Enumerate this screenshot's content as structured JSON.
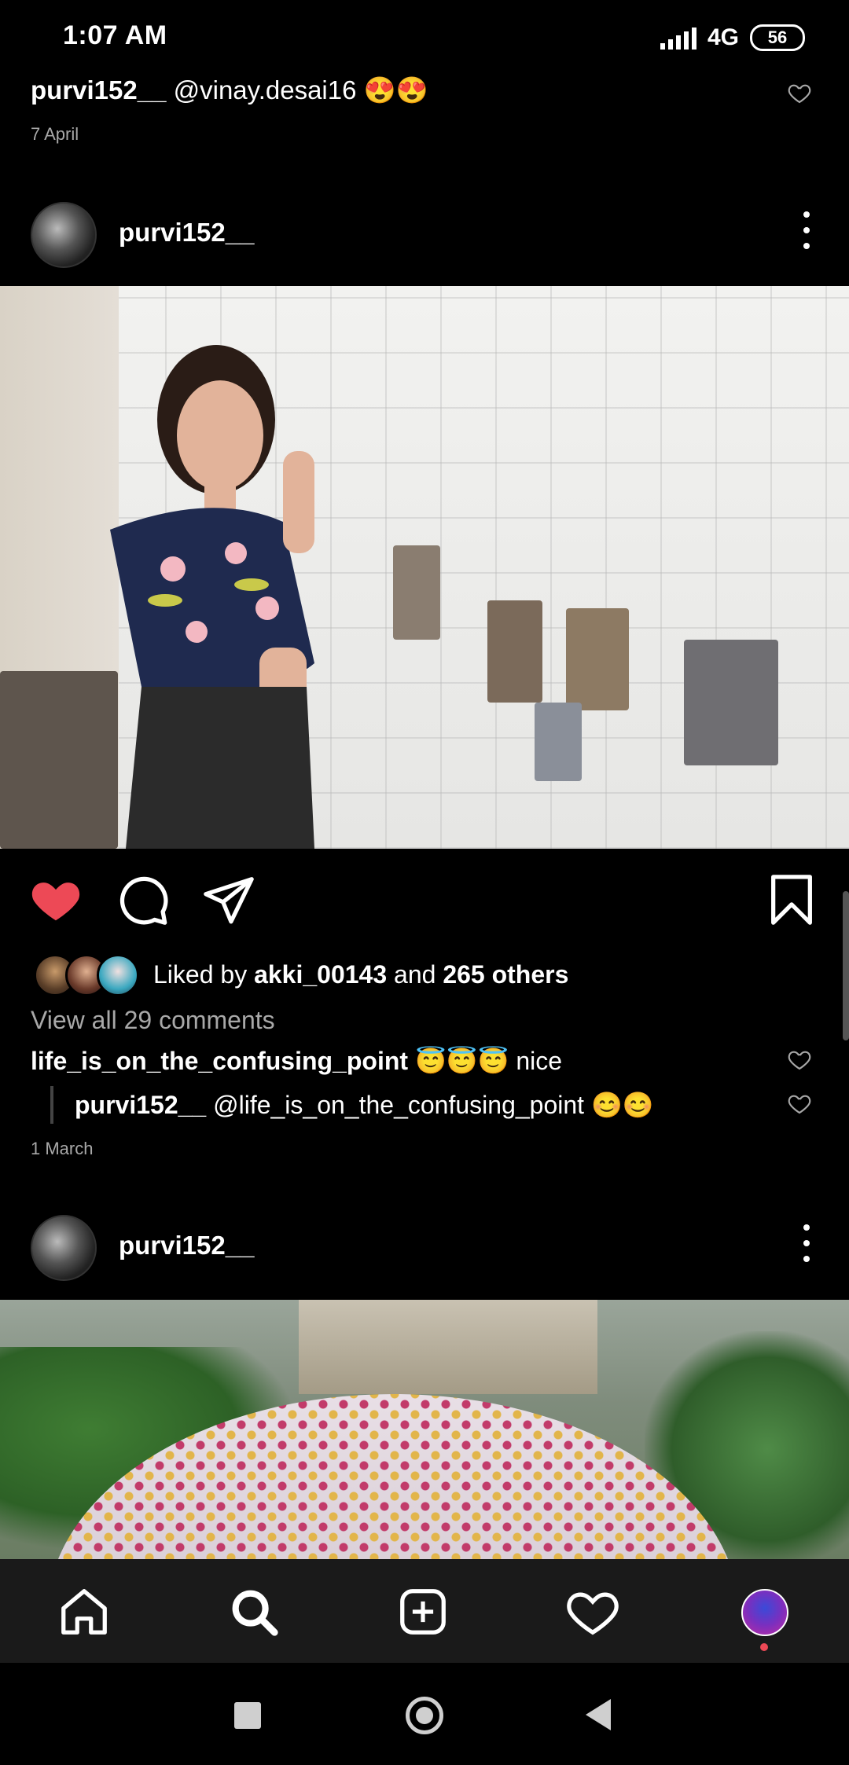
{
  "status_bar": {
    "time": "1:07 AM",
    "network": "4G",
    "battery": "56"
  },
  "top_caption": {
    "username": "purvi152__",
    "text": " @vinay.desai16 😍😍",
    "date": "7 April"
  },
  "post1": {
    "username": "purvi152__",
    "liked_by_prefix": "Liked by ",
    "liked_by_user": "akki_00143",
    "liked_by_mid": " and ",
    "liked_by_others": "265 others",
    "view_comments": "View all 29 comments",
    "comments": [
      {
        "username": "life_is_on_the_confusing_point",
        "text": " 😇😇😇 nice"
      },
      {
        "username": "purvi152__",
        "text": " @life_is_on_the_confusing_point 😊😊"
      }
    ],
    "date": "1 March"
  },
  "post2": {
    "username": "purvi152__"
  },
  "colors": {
    "like_red": "#ed4956",
    "secondary_text": "#a8a8a8",
    "nav_bg": "#1a1a1a"
  },
  "icons": {
    "action_bar": [
      "heart-filled-icon",
      "comment-icon",
      "share-icon",
      "bookmark-icon"
    ],
    "bottom_nav": [
      "home-icon",
      "search-icon",
      "add-post-icon",
      "activity-heart-icon",
      "profile-avatar"
    ]
  }
}
